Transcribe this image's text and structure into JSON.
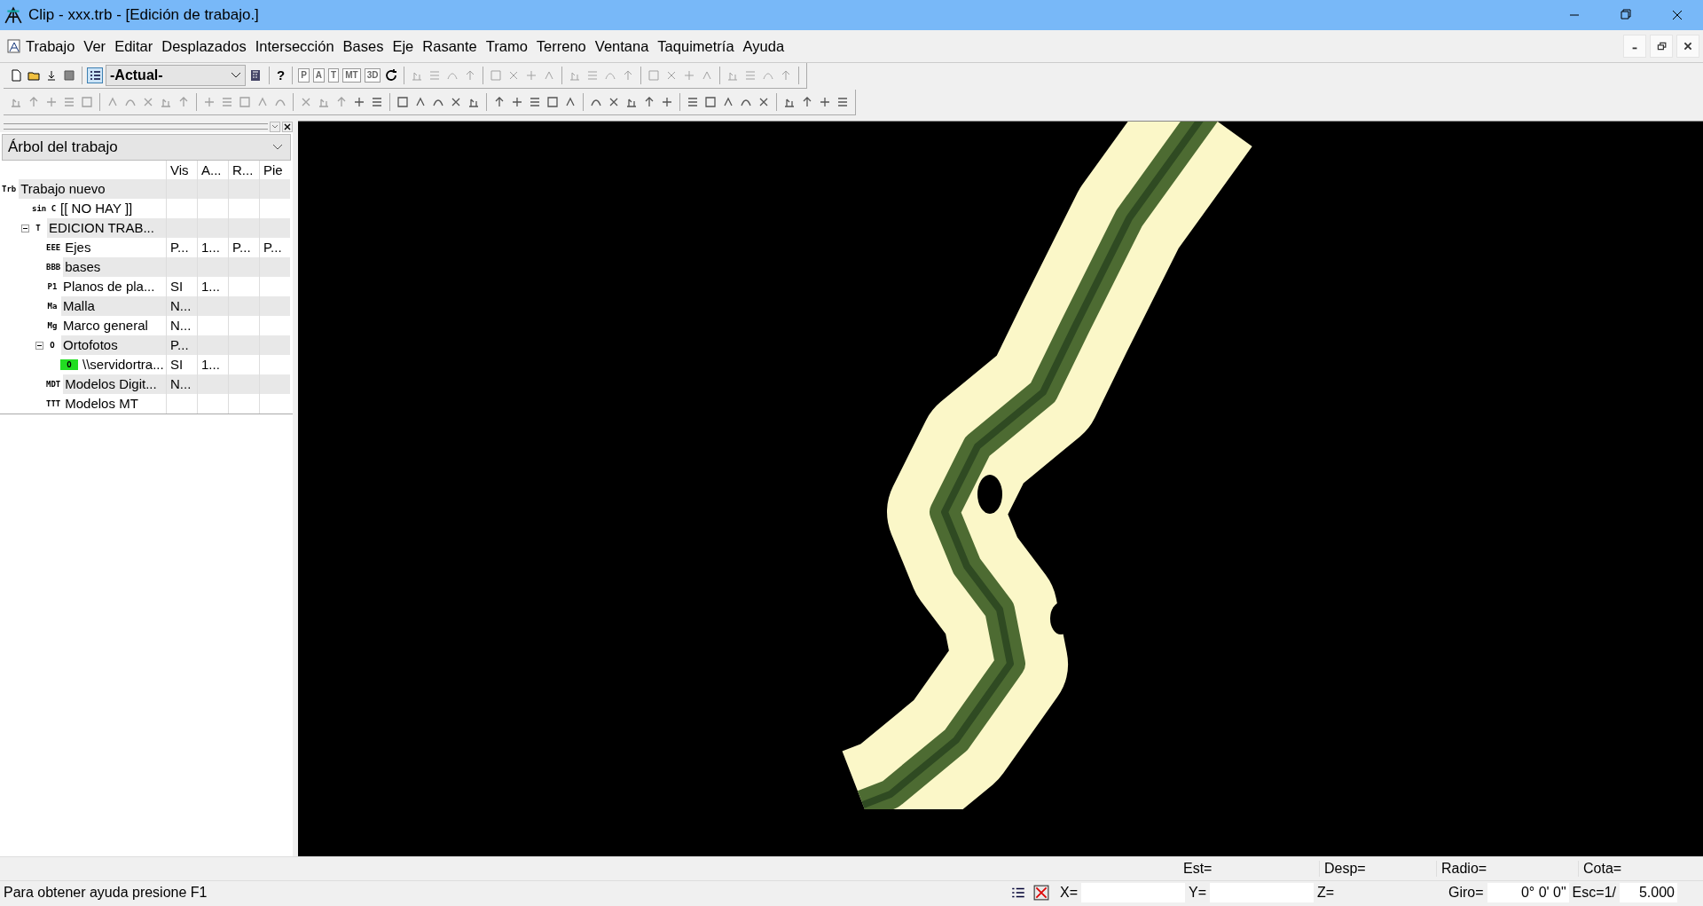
{
  "window": {
    "title": "Clip - xxx.trb - [Edición de trabajo.]"
  },
  "menu": [
    "Trabajo",
    "Ver",
    "Editar",
    "Desplazados",
    "Intersección",
    "Bases",
    "Eje",
    "Rasante",
    "Tramo",
    "Terreno",
    "Ventana",
    "Taquimetría",
    "Ayuda"
  ],
  "toolbar": {
    "help_key": "?",
    "keys": [
      "P",
      "A",
      "T",
      "MT",
      "3D"
    ],
    "view_combo": {
      "value": "-Actual-"
    },
    "tree_toggle": {
      "selected": true
    }
  },
  "tree_panel": {
    "title": "Árbol del trabajo",
    "columns": [
      "Vis",
      "A...",
      "R...",
      "Pie"
    ],
    "rows": [
      {
        "badge": "Trb",
        "name": "Trabajo nuevo",
        "cells": [
          "",
          "",
          "",
          ""
        ],
        "children": [
          {
            "badge": "sin C",
            "name": "[[ NO HAY ]]",
            "cells": [
              "",
              "",
              "",
              ""
            ]
          },
          {
            "badge": "T",
            "name": "EDICION TRAB...",
            "cells": [
              "",
              "",
              "",
              ""
            ],
            "expanded": true,
            "children": [
              {
                "badge": "EEE",
                "name": "Ejes",
                "cells": [
                  "P...",
                  "1...",
                  "P...",
                  "P..."
                ]
              },
              {
                "badge": "BBB",
                "name": "bases",
                "cells": [
                  "",
                  "",
                  "",
                  ""
                ]
              },
              {
                "badge": "P1",
                "name": "Planos de pla...",
                "cells": [
                  "SI",
                  "1...",
                  "",
                  ""
                ]
              },
              {
                "badge": "Ma",
                "name": "Malla",
                "cells": [
                  "N...",
                  "",
                  "",
                  ""
                ]
              },
              {
                "badge": "Mg",
                "name": "Marco general",
                "cells": [
                  "N...",
                  "",
                  "",
                  ""
                ]
              },
              {
                "badge": "O",
                "name": "Ortofotos",
                "cells": [
                  "P...",
                  "",
                  "",
                  ""
                ],
                "expanded": true,
                "children": [
                  {
                    "badge": "O",
                    "color": "#22dd22",
                    "name": "\\\\servidortra...",
                    "cells": [
                      "SI",
                      "1...",
                      "",
                      ""
                    ]
                  }
                ]
              },
              {
                "badge": "MDT",
                "name": "Modelos Digit...",
                "cells": [
                  "N...",
                  "",
                  "",
                  ""
                ]
              },
              {
                "badge": "TTT",
                "name": "Modelos MT",
                "cells": [
                  "",
                  "",
                  "",
                  ""
                ]
              }
            ]
          }
        ]
      }
    ]
  },
  "status_bar": {
    "help": "Para obtener ayuda presione F1",
    "labels": [
      "Est=",
      "Desp=",
      "Radio=",
      "Cota="
    ],
    "x_label": "X=",
    "y_label": "Y=",
    "z_label": "Z=",
    "giro_label": "Giro=",
    "giro_value": "0° 0' 0\"",
    "scale_label": "Esc=1/",
    "scale_value": "5.000"
  }
}
